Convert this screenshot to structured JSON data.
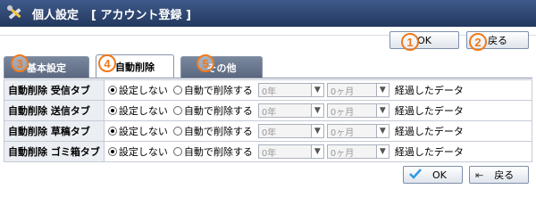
{
  "header": {
    "title": "個人設定",
    "subtitle": "[ アカウント登録 ]",
    "icon": "tools-icon"
  },
  "toolbar_top": {
    "ok_label": "OK",
    "back_label": "戻る"
  },
  "markers": [
    "1",
    "2",
    "3",
    "4",
    "5"
  ],
  "tabs": [
    {
      "label": "基本設定",
      "active": false
    },
    {
      "label": "自動削除",
      "active": true
    },
    {
      "label": "その他",
      "active": false
    }
  ],
  "rows": [
    {
      "label": "自動削除 受信タブ"
    },
    {
      "label": "自動削除 送信タブ"
    },
    {
      "label": "自動削除 草稿タブ"
    },
    {
      "label": "自動削除 ゴミ箱タブ"
    }
  ],
  "row_options": {
    "radio_off_label": "設定しない",
    "radio_auto_label": "自動で削除する",
    "year_value": "0年",
    "month_value": "0ヶ月",
    "after_text": "経過したデータ"
  },
  "toolbar_bottom": {
    "ok_label": "OK",
    "back_label": "戻る"
  },
  "colors": {
    "titlebar": "#2c4470",
    "marker": "#f07a1a",
    "tab_inactive": "#6a7890",
    "label_bg": "#ebeef3"
  }
}
